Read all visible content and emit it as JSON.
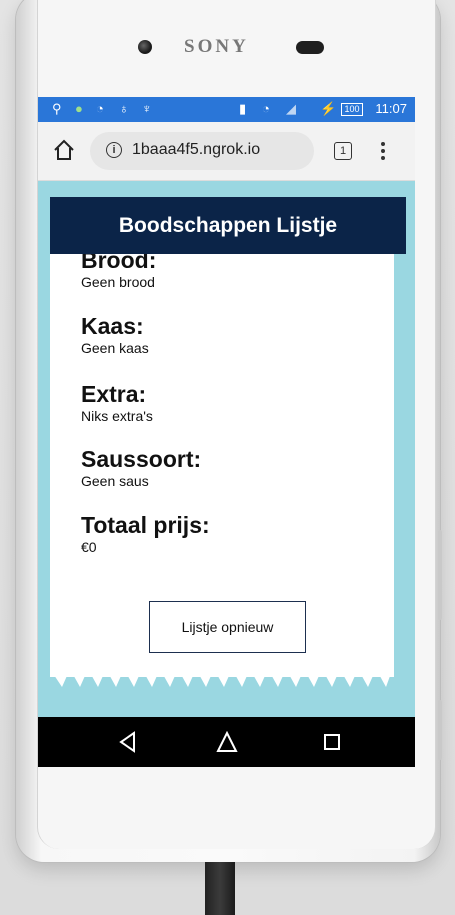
{
  "device": {
    "brand": "SONY"
  },
  "status_bar": {
    "time": "11:07",
    "battery": "100",
    "icons": [
      "usb-icon",
      "android-icon",
      "sync-icon",
      "alarm-icon",
      "bug-icon",
      "signal-icon",
      "wifi-icon",
      "charging-icon"
    ]
  },
  "browser": {
    "url": "1baaa4f5.ngrok.io",
    "tab_count": "1"
  },
  "page": {
    "header": "Boodschappen Lijstje",
    "sections": [
      {
        "title": "Brood:",
        "value": "Geen brood"
      },
      {
        "title": "Kaas:",
        "value": "Geen kaas"
      },
      {
        "title": "Extra:",
        "value": "Niks extra's"
      },
      {
        "title": "Saussoort:",
        "value": "Geen saus"
      },
      {
        "title": "Totaal prijs:",
        "value": "€0"
      }
    ],
    "reset_button": "Lijstje opnieuw"
  },
  "colors": {
    "header_bg": "#0b2448",
    "background": "#9ad7e1",
    "status_bar": "#2a76d8"
  }
}
